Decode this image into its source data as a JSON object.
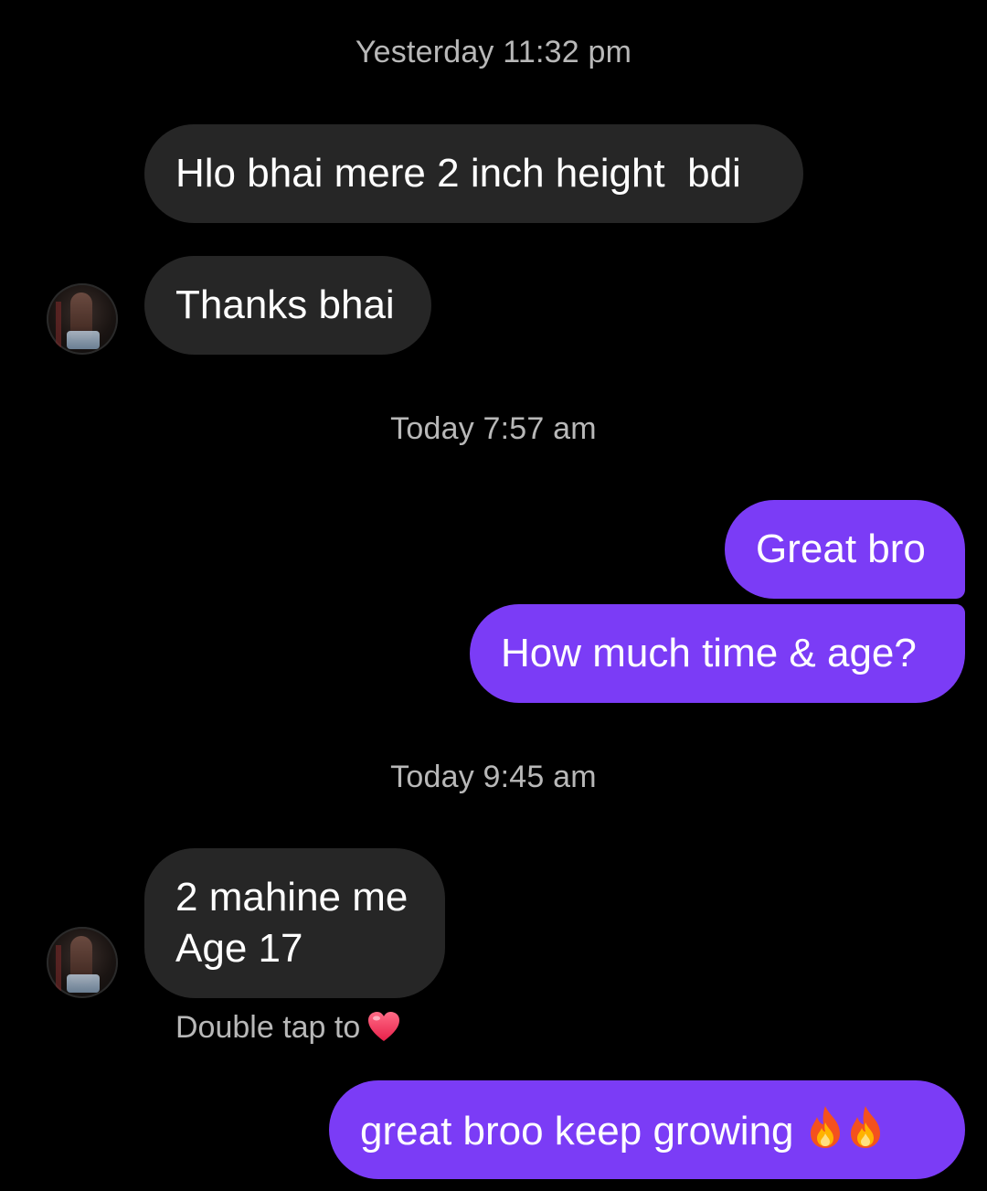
{
  "timestamps": {
    "first": "Yesterday 11:32 pm",
    "second": "Today 7:57 am",
    "third": "Today 9:45 am"
  },
  "messages": {
    "m1": "Hlo bhai mere 2 inch height  bdi",
    "m2": "Thanks bhai",
    "m3": "Great bro",
    "m4": "How much time & age?",
    "m5_line1": "2 mahine me",
    "m5_line2": "Age 17",
    "m6": "great broo keep growing "
  },
  "reaction_hint": {
    "label": "Double tap to"
  },
  "icons": {
    "reaction": "heart-icon",
    "emoji": "fire-emoji"
  },
  "colors": {
    "background": "#000000",
    "incoming_bubble": "#262626",
    "outgoing_bubble": "#7b3cf6",
    "timestamp_text": "#b8b8b8"
  }
}
